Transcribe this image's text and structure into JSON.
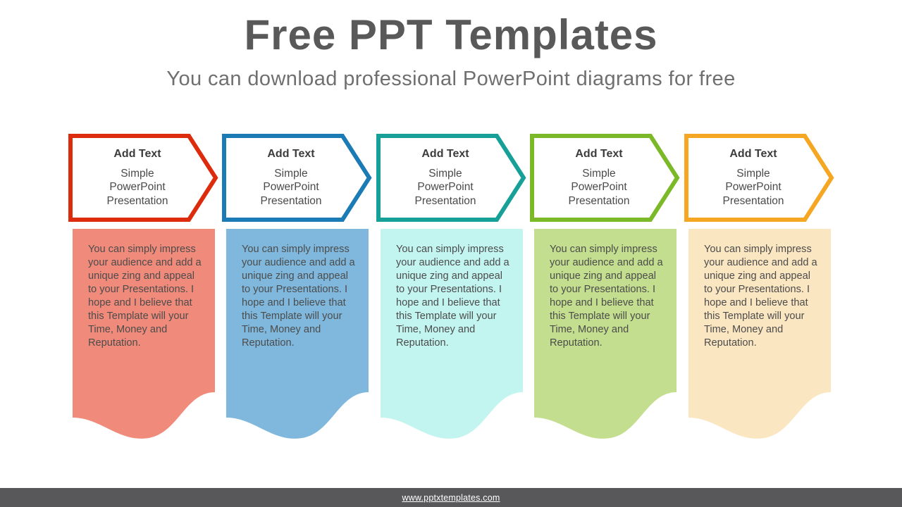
{
  "header": {
    "title": "Free PPT Templates",
    "subtitle": "You can download  professional PowerPoint  diagrams  for free"
  },
  "colors": {
    "title_text": "#595959",
    "subtitle_text": "#6f6f6f",
    "footer_bar": "#58585a",
    "footer_link": "#ffffff"
  },
  "columns": [
    {
      "index": 1,
      "accent": "#dd2b0e",
      "panel_fill": "#f08a7a",
      "chevron_fill": "#ffffff",
      "heading": "Add Text",
      "subheading": "Simple\nPowerPoint\nPresentation",
      "body": "You can simply impress your audience and add a unique zing and appeal to your Presentations. I hope and I believe that this Template will your Time, Money and Reputation."
    },
    {
      "index": 2,
      "accent": "#1b7bb5",
      "panel_fill": "#7fb8dc",
      "chevron_fill": "#ffffff",
      "heading": "Add Text",
      "subheading": "Simple\nPowerPoint\nPresentation",
      "body": "You can simply impress your audience and add a unique zing and appeal to your Presentations. I hope and I believe that this Template will your Time, Money and Reputation."
    },
    {
      "index": 3,
      "accent": "#16a098",
      "panel_fill": "#c3f5f0",
      "chevron_fill": "#ffffff",
      "heading": "Add Text",
      "subheading": "Simple\nPowerPoint\nPresentation",
      "body": "You can simply impress your audience and add a unique zing and appeal to your Presentations. I hope and I believe that this Template will your Time, Money and Reputation."
    },
    {
      "index": 4,
      "accent": "#7cb928",
      "panel_fill": "#c3de8e",
      "chevron_fill": "#ffffff",
      "heading": "Add Text",
      "subheading": "Simple\nPowerPoint\nPresentation",
      "body": "You can simply impress your audience and add a unique zing and appeal to your Presentations. I hope and I believe that this Template will your Time, Money and Reputation."
    },
    {
      "index": 5,
      "accent": "#f5a623",
      "panel_fill": "#fbe6c2",
      "chevron_fill": "#ffffff",
      "heading": "Add Text",
      "subheading": "Simple\nPowerPoint\nPresentation",
      "body": "You can simply impress your audience and add a unique zing and appeal to your Presentations. I hope and I believe that this Template will your Time, Money and Reputation."
    }
  ],
  "footer": {
    "link_text": "www.pptxtemplates.com"
  }
}
